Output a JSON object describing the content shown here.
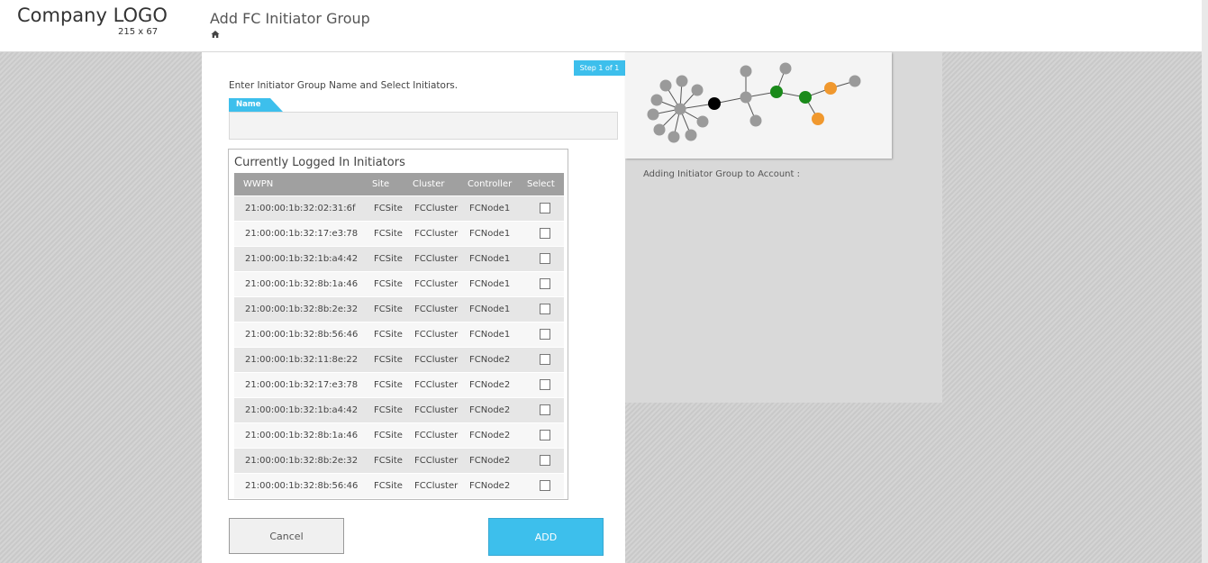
{
  "header": {
    "logo_text": "Company LOGO",
    "logo_size": "215 x 67",
    "title": "Add FC Initiator Group"
  },
  "form": {
    "step_badge": "Step 1 of 1",
    "instructions": "Enter Initiator Group Name and Select Initiators.",
    "name_label": "Name",
    "name_value": "",
    "name_placeholder": ""
  },
  "table": {
    "title": "Currently Logged In Initiators",
    "columns": [
      "WWPN",
      "Site",
      "Cluster",
      "Controller",
      "Select"
    ],
    "rows": [
      {
        "wwpn": "21:00:00:1b:32:02:31:6f",
        "site": "FCSite",
        "cluster": "FCCluster",
        "controller": "FCNode1",
        "selected": false
      },
      {
        "wwpn": "21:00:00:1b:32:17:e3:78",
        "site": "FCSite",
        "cluster": "FCCluster",
        "controller": "FCNode1",
        "selected": false
      },
      {
        "wwpn": "21:00:00:1b:32:1b:a4:42",
        "site": "FCSite",
        "cluster": "FCCluster",
        "controller": "FCNode1",
        "selected": false
      },
      {
        "wwpn": "21:00:00:1b:32:8b:1a:46",
        "site": "FCSite",
        "cluster": "FCCluster",
        "controller": "FCNode1",
        "selected": false
      },
      {
        "wwpn": "21:00:00:1b:32:8b:2e:32",
        "site": "FCSite",
        "cluster": "FCCluster",
        "controller": "FCNode1",
        "selected": false
      },
      {
        "wwpn": "21:00:00:1b:32:8b:56:46",
        "site": "FCSite",
        "cluster": "FCCluster",
        "controller": "FCNode1",
        "selected": false
      },
      {
        "wwpn": "21:00:00:1b:32:11:8e:22",
        "site": "FCSite",
        "cluster": "FCCluster",
        "controller": "FCNode2",
        "selected": false
      },
      {
        "wwpn": "21:00:00:1b:32:17:e3:78",
        "site": "FCSite",
        "cluster": "FCCluster",
        "controller": "FCNode2",
        "selected": false
      },
      {
        "wwpn": "21:00:00:1b:32:1b:a4:42",
        "site": "FCSite",
        "cluster": "FCCluster",
        "controller": "FCNode2",
        "selected": false
      },
      {
        "wwpn": "21:00:00:1b:32:8b:1a:46",
        "site": "FCSite",
        "cluster": "FCCluster",
        "controller": "FCNode2",
        "selected": false
      },
      {
        "wwpn": "21:00:00:1b:32:8b:2e:32",
        "site": "FCSite",
        "cluster": "FCCluster",
        "controller": "FCNode2",
        "selected": false
      },
      {
        "wwpn": "21:00:00:1b:32:8b:56:46",
        "site": "FCSite",
        "cluster": "FCCluster",
        "controller": "FCNode2",
        "selected": false
      }
    ]
  },
  "buttons": {
    "cancel_label": "Cancel",
    "add_label": "ADD"
  },
  "side": {
    "account_label": "Adding Initiator Group to Account :"
  },
  "colors": {
    "accent": "#3dbfec",
    "node_gray": "#9a9a9a",
    "node_black": "#000000",
    "node_green": "#1a8a1a",
    "node_orange": "#f0982e"
  }
}
